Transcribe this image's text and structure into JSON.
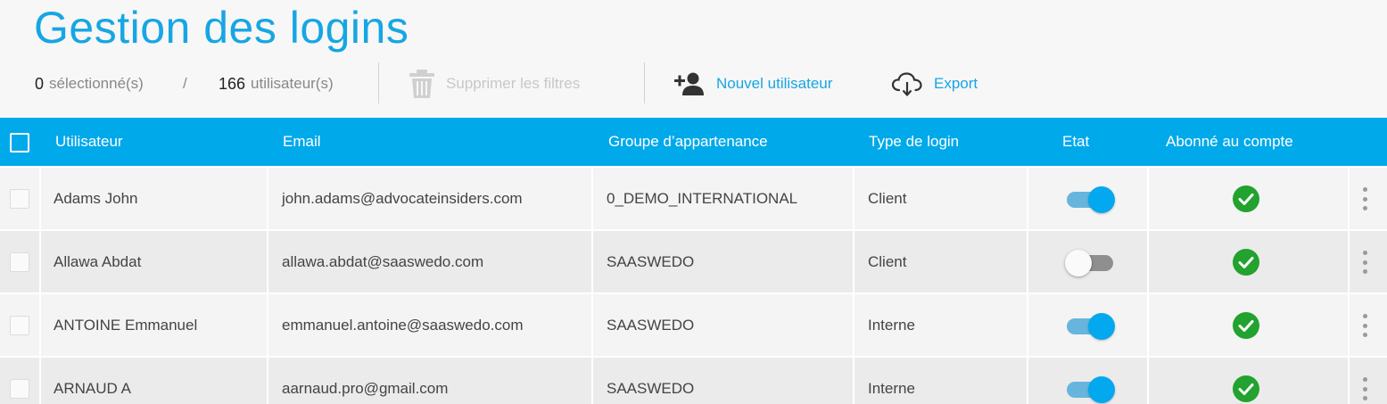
{
  "page": {
    "title": "Gestion des logins"
  },
  "toolbar": {
    "selected_count": "0",
    "selected_label": "sélectionné(s)",
    "separator": "/",
    "user_count": "166",
    "user_label": "utilisateur(s)",
    "clear_filters": "Supprimer les filtres",
    "new_user": "Nouvel utilisateur",
    "export": "Export"
  },
  "table": {
    "headers": {
      "user": "Utilisateur",
      "email": "Email",
      "group": "Groupe d’appartenance",
      "login_type": "Type de login",
      "state": "Etat",
      "subscribed": "Abonné au compte"
    },
    "rows": [
      {
        "user": "Adams John",
        "email": "john.adams@advocateinsiders.com",
        "group": "0_DEMO_INTERNATIONAL",
        "login_type": "Client",
        "state_on": true,
        "subscribed": true
      },
      {
        "user": "Allawa Abdat",
        "email": "allawa.abdat@saaswedo.com",
        "group": "SAASWEDO",
        "login_type": "Client",
        "state_on": false,
        "subscribed": true
      },
      {
        "user": "ANTOINE Emmanuel",
        "email": "emmanuel.antoine@saaswedo.com",
        "group": "SAASWEDO",
        "login_type": "Interne",
        "state_on": true,
        "subscribed": true
      },
      {
        "user": "ARNAUD A",
        "email": "aarnaud.pro@gmail.com",
        "group": "SAASWEDO",
        "login_type": "Interne",
        "state_on": true,
        "subscribed": true
      }
    ]
  },
  "colors": {
    "accent": "#16a6e3",
    "header_bg": "#00a9ea",
    "toggle_on": "#03a8ef",
    "check_green": "#22a22e"
  },
  "icons": {
    "delete": "trash-icon",
    "add_user": "add-user-icon",
    "export": "cloud-download-icon",
    "subscribed": "check-circle-icon",
    "row_menu": "more-vertical-icon"
  }
}
